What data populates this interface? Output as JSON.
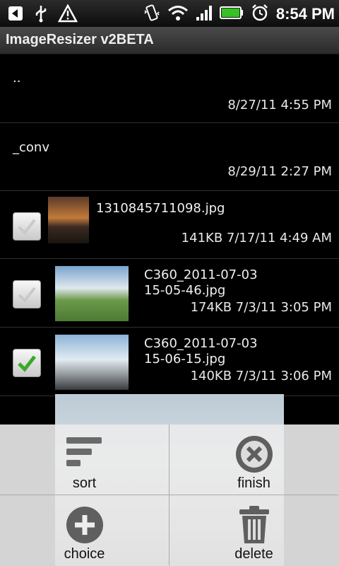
{
  "status_bar": {
    "time": "8:54 PM",
    "left_icons": [
      "back-arrow-icon",
      "usb-icon",
      "warning-icon"
    ],
    "right_icons": [
      "vibrate-icon",
      "wifi-icon",
      "signal-icon",
      "battery-icon",
      "alarm-icon"
    ]
  },
  "app": {
    "title": "ImageResizer v2BETA"
  },
  "list": {
    "directories": [
      {
        "name": "..",
        "date": "8/27/11 4:55 PM"
      },
      {
        "name": "_conv",
        "date": "8/29/11 2:27 PM"
      }
    ],
    "files": [
      {
        "name_line1": "1310845711098.jpg",
        "name_line2": "",
        "meta": "141KB  7/17/11 4:49 AM",
        "checked": false
      },
      {
        "name_line1": "C360_2011-07-03",
        "name_line2": "15-05-46.jpg",
        "meta": "174KB  7/3/11 3:05 PM",
        "checked": false
      },
      {
        "name_line1": "C360_2011-07-03",
        "name_line2": "15-06-15.jpg",
        "meta": "140KB  7/3/11 3:06 PM",
        "checked": true
      }
    ]
  },
  "menu": {
    "sort": "sort",
    "finish": "finish",
    "choice": "choice",
    "delete": "delete"
  },
  "colors": {
    "check_green": "#3aa82a",
    "menu_bg": "#ebebeb"
  }
}
